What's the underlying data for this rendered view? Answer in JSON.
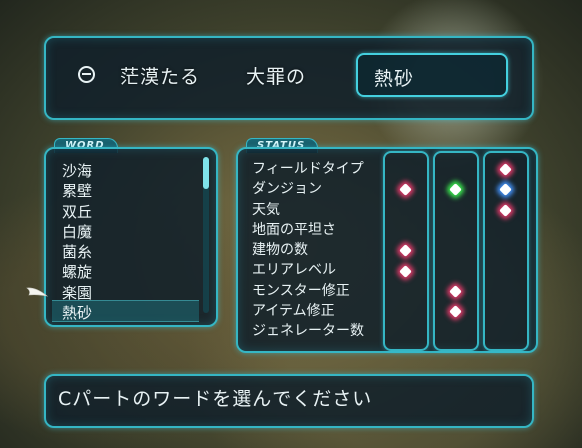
{
  "header": {
    "minus_icon": "minus-circle-icon",
    "word1": "茫漠たる",
    "word2": "大罪の",
    "selected_word": "熱砂"
  },
  "word_panel": {
    "tab_label": "WORD",
    "items": [
      "沙海",
      "累壁",
      "双丘",
      "白魔",
      "菌糸",
      "螺旋",
      "楽園",
      "熱砂"
    ],
    "selected_index": 7
  },
  "status_panel": {
    "tab_label": "STATUS",
    "rows": [
      "フィールドタイプ",
      "ダンジョン",
      "天気",
      "地面の平坦さ",
      "建物の数",
      "エリアレベル",
      "モンスター修正",
      "アイテム修正",
      "ジェネレーター数"
    ],
    "columns": [
      {
        "gems": [
          {
            "row": 1,
            "color": "red"
          },
          {
            "row": 4,
            "color": "red"
          },
          {
            "row": 5,
            "color": "red"
          }
        ]
      },
      {
        "gems": [
          {
            "row": 1,
            "color": "green"
          },
          {
            "row": 6,
            "color": "red"
          },
          {
            "row": 7,
            "color": "red"
          }
        ]
      },
      {
        "gems": [
          {
            "row": 0,
            "color": "red"
          },
          {
            "row": 1,
            "color": "blue"
          },
          {
            "row": 2,
            "color": "red"
          }
        ]
      }
    ]
  },
  "footer": {
    "message": "Cパートのワードを選んでください"
  },
  "colors": {
    "frame": "#35b6c4",
    "panel_bg": "#10202a",
    "text": "#e8f2f4"
  }
}
